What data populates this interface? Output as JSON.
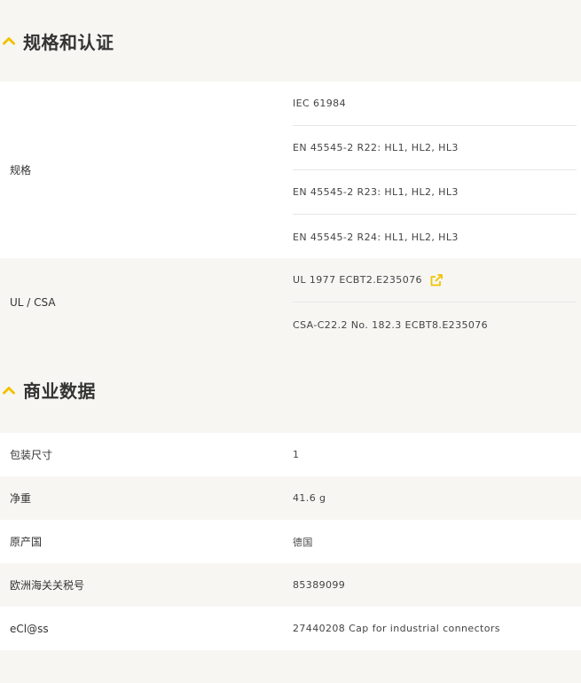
{
  "accent_color": "#f2c200",
  "standards_section": {
    "title": "规格和认证",
    "icon": "chevron-up-icon",
    "rows": [
      {
        "label": "规格",
        "values": [
          "IEC 61984",
          "EN 45545-2 R22: HL1, HL2, HL3",
          "EN 45545-2 R23: HL1, HL2, HL3",
          "EN 45545-2 R24: HL1, HL2, HL3"
        ]
      },
      {
        "label": "UL / CSA",
        "values": [
          "UL 1977 ECBT2.E235076",
          "CSA-C22.2 No. 182.3 ECBT8.E235076"
        ],
        "link_icon": "external-link-icon"
      }
    ]
  },
  "commercial_section": {
    "title": "商业数据",
    "icon": "chevron-up-icon",
    "rows": [
      {
        "label": "包装尺寸",
        "value": "1"
      },
      {
        "label": "净重",
        "value": "41.6 g"
      },
      {
        "label": "原产国",
        "value": "德国"
      },
      {
        "label": "欧洲海关关税号",
        "value": "85389099"
      },
      {
        "label": "eCl@ss",
        "value": "27440208 Cap for industrial connectors"
      }
    ]
  }
}
